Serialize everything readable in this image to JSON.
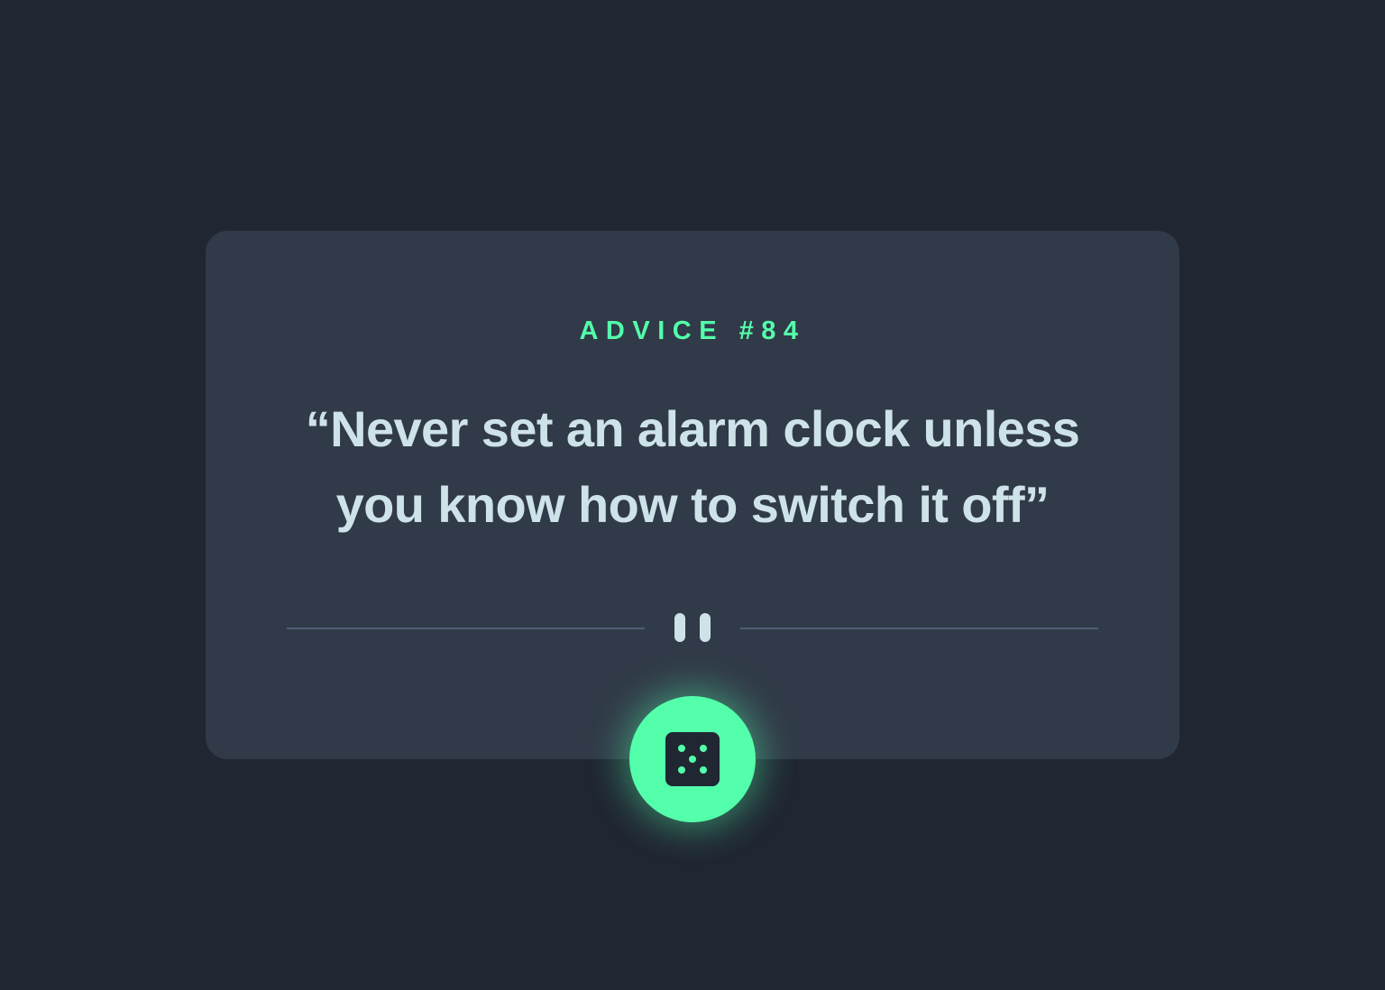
{
  "advice": {
    "id_label": "ADVICE #84",
    "quote": "“Never set an alarm clock unless you know how to switch it off”"
  },
  "divider": {
    "icon": "pause-icon"
  },
  "dice_button": {
    "icon": "dice-icon"
  },
  "colors": {
    "background": "#202632",
    "card": "#313A48",
    "accent": "#53FFAA",
    "text": "#CEE3E9",
    "divider": "#4F5D74"
  }
}
